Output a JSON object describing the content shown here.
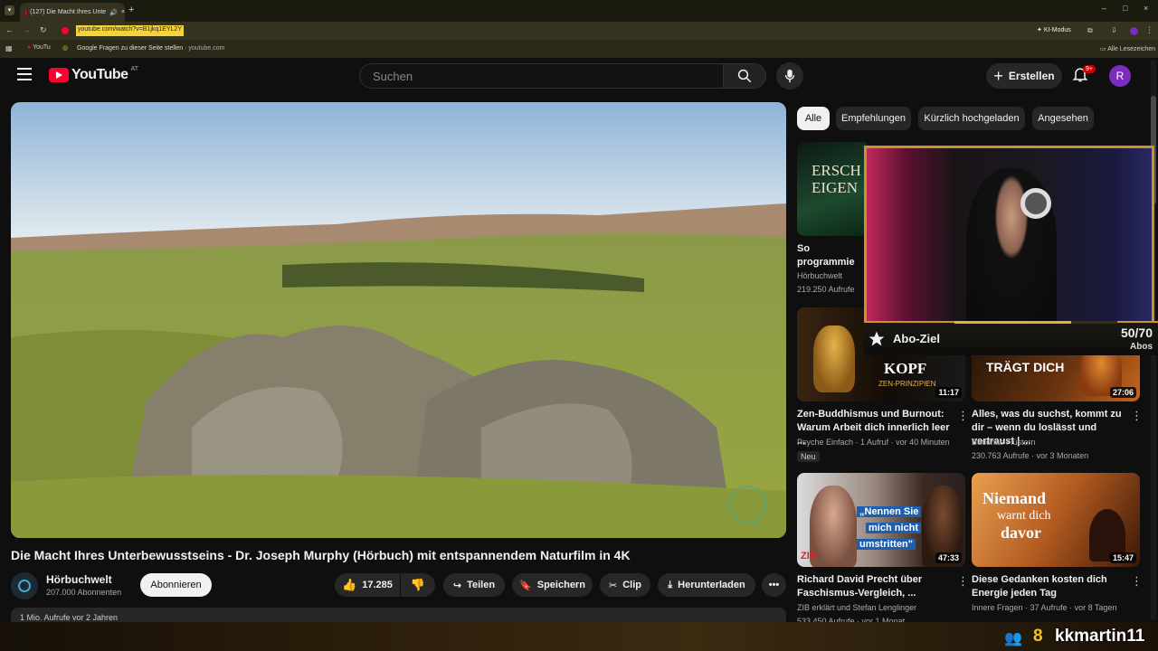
{
  "browser": {
    "tab_title": "(127) Die Macht Ihres Unte",
    "url": "youtube.com/watch?v=B1jkq1EYL2Y",
    "bookmark_tab": "YouTu",
    "google_ask": "Google Fragen zu dieser Seite stellen",
    "google_ask_domain": "youtube.com",
    "ki_mode": "KI-Modus",
    "all_bookmarks": "Alle Lesezeichen"
  },
  "header": {
    "logo_text": "YouTube",
    "country": "AT",
    "search_placeholder": "Suchen",
    "create_label": "Erstellen",
    "notif_badge": "9+",
    "avatar_letter": "R"
  },
  "video": {
    "title": "Die Macht Ihres Unterbewusstseins - Dr. Joseph Murphy (Hörbuch) mit entspannendem Naturfilm in 4K",
    "channel": "Hörbuchwelt",
    "subscribers": "207.000 Abonnenten",
    "subscribe_label": "Abonnieren",
    "likes": "17.285",
    "share_label": "Teilen",
    "save_label": "Speichern",
    "clip_label": "Clip",
    "download_label": "Herunterladen",
    "description_preview": "1 Mio. Aufrufe  vor 2 Jahren"
  },
  "chips": [
    "Alle",
    "Empfehlungen",
    "Kürzlich hochgeladen",
    "Angesehen"
  ],
  "recs": [
    {
      "title": "So programmie Unterbewussts",
      "channel": "Hörbuchwelt",
      "meta": "219.250 Aufrufe",
      "thumb_text": "ERSCH EIGEN",
      "duration": ""
    },
    {
      "title": "Zen-Buddhismus und Burnout: Warum Arbeit dich innerlich leer ...",
      "channel": "Psyche Einfach",
      "meta": "1 Aufruf · vor 40 Minuten",
      "badge": "Neu",
      "thumb_text": "KOPF",
      "thumb_sub": "ZEN-PRINZIPIEN",
      "duration": "11:17"
    },
    {
      "title": "Alles, was du suchst, kommt zu dir – wenn du loslässt und vertraust | ...",
      "channel": "Buddhas Flüstern",
      "meta": "230.763 Aufrufe · vor 3 Monaten",
      "thumb_text": "TRÄGT DICH",
      "duration": "27:06"
    },
    {
      "title": "Richard David Precht über Faschismus-Vergleich, ...",
      "channel": "ZIB erklärt und Stefan Lenglinger",
      "meta": "533.450 Aufrufe · vor 1 Monat",
      "thumb_text_1": "„Nennen Sie",
      "thumb_text_2": "mich nicht",
      "thumb_text_3": "umstritten\"",
      "thumb_logo": "ZIB",
      "duration": "47:33"
    },
    {
      "title": "Diese Gedanken kosten dich Energie jeden Tag",
      "channel": "Innere Fragen",
      "meta": "37 Aufrufe · vor 8 Tagen",
      "thumb_text_1": "Niemand",
      "thumb_text_2": "warnt dich",
      "thumb_text_3": "davor",
      "duration": "15:47"
    }
  ],
  "stream": {
    "goal_label": "Abo-Ziel",
    "goal_count": "50/70",
    "goal_unit": "Abos",
    "goal_progress": 0.714,
    "viewers": "8",
    "streamer": "kkmartin11"
  },
  "colors": {
    "accent_red": "#ff0033",
    "gold": "#c9922a",
    "chip_active": "#f1f1f1"
  }
}
